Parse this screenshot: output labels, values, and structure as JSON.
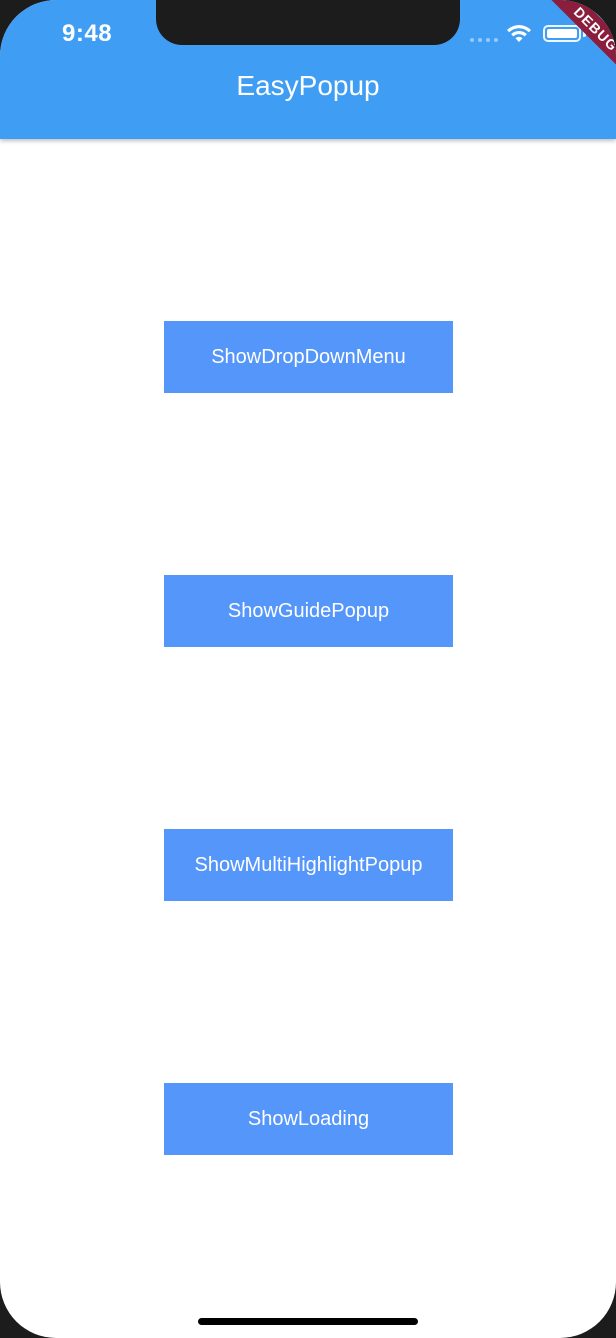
{
  "status_bar": {
    "time": "9:48",
    "debug_banner": "DEBUG"
  },
  "app_bar": {
    "title": "EasyPopup",
    "color": "#3f9ef4"
  },
  "buttons": [
    {
      "label": "ShowDropDownMenu"
    },
    {
      "label": "ShowGuidePopup"
    },
    {
      "label": "ShowMultiHighlightPopup"
    },
    {
      "label": "ShowLoading"
    }
  ],
  "colors": {
    "button_bg": "#5596fb",
    "button_text": "#ffffff",
    "debug_ribbon": "#8a1e3c"
  },
  "icons": [
    "signal-icon",
    "wifi-icon",
    "battery-icon"
  ]
}
